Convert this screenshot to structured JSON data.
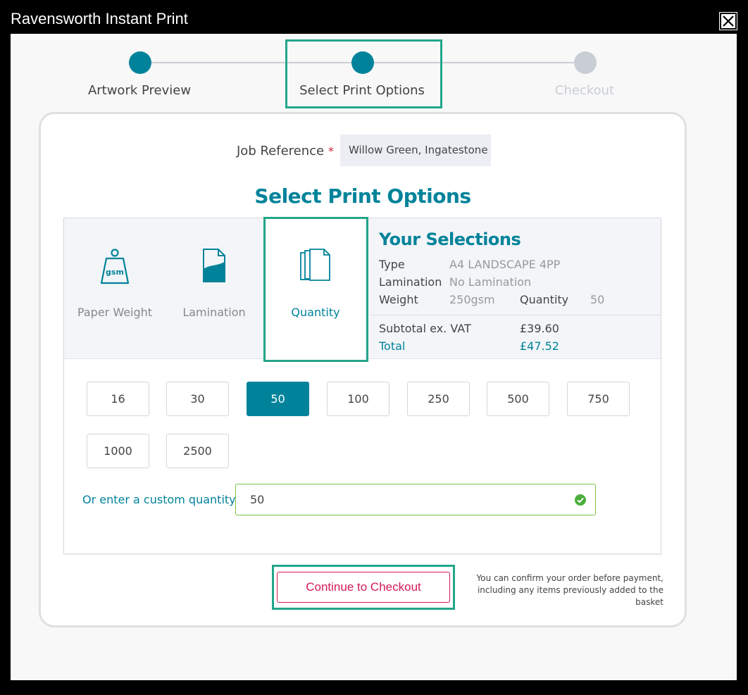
{
  "window": {
    "title": "Ravensworth Instant Print"
  },
  "stepper": {
    "steps": [
      {
        "label": "Artwork Preview",
        "state": "complete"
      },
      {
        "label": "Select Print Options",
        "state": "current"
      },
      {
        "label": "Checkout",
        "state": "upcoming"
      }
    ]
  },
  "job_reference": {
    "label": "Job Reference",
    "required_mark": "*",
    "value": "Willow Green, Ingatestone"
  },
  "section_title": "Select Print Options",
  "options_tabs": [
    {
      "label": "Paper Weight",
      "icon": "weight-gsm-icon",
      "icon_text": "gsm"
    },
    {
      "label": "Lamination",
      "icon": "lamination-icon"
    },
    {
      "label": "Quantity",
      "icon": "stacked-pages-icon",
      "selected": true
    }
  ],
  "selections": {
    "title": "Your Selections",
    "type_label": "Type",
    "type_value": "A4 LANDSCAPE 4PP",
    "lamination_label": "Lamination",
    "lamination_value": "No Lamination",
    "weight_label": "Weight",
    "weight_value": "250gsm",
    "quantity_label": "Quantity",
    "quantity_value": "50",
    "subtotal_label": "Subtotal ex. VAT",
    "subtotal_value": "£39.60",
    "total_label": "Total",
    "total_value": "£47.52"
  },
  "quantities": [
    "16",
    "30",
    "50",
    "100",
    "250",
    "500",
    "750",
    "1000",
    "2500"
  ],
  "selected_quantity": "50",
  "custom_quantity": {
    "label": "Or enter a custom quantity",
    "value": "50"
  },
  "checkout": {
    "button_label": "Continue to Checkout",
    "note": "You can confirm your order before payment, including any items previously added to the basket"
  },
  "colors": {
    "accent": "#00839a",
    "highlight": "#22a68a",
    "checkout": "#d4185a",
    "valid": "#7cc242"
  }
}
